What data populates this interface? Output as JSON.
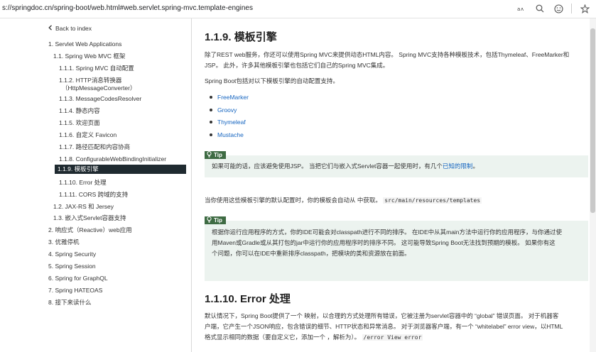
{
  "browser": {
    "url": "s://springdoc.cn/spring-boot/web.html#web.servlet.spring-mvc.template-engines",
    "icons": [
      "reader-mode-icon",
      "zoom-icon",
      "translate-icon",
      "favorite-icon"
    ]
  },
  "sidebar": {
    "back_label": "Back to index",
    "items": [
      "1. Servlet Web Applications",
      "1.1. Spring Web MVC 框架",
      "1.1.1. Spring MVC 自动配置",
      "1.1.2. HTTP消息转换器",
      "（HttpMessageConverter）",
      "1.1.3. MessageCodesResolver",
      "1.1.4. 静态内容",
      "1.1.5. 欢迎页面",
      "1.1.6. 自定义 Favicon",
      "1.1.7. 路径匹配和内容协商",
      "1.1.8. ConfigurableWebBindingInitializer",
      "1.1.9. 模板引擎",
      "1.1.10. Error 处理",
      "1.1.11. CORS 跨域的支持",
      "1.2. JAX-RS 和 Jersey",
      "1.3. 嵌入式Servlet容器支持",
      "2. 响应式（Reactive）web应用",
      "3. 优雅停机",
      "4. Spring Security",
      "5. Spring Session",
      "6. Spring for GraphQL",
      "7. Spring HATEOAS",
      "8. 接下来读什么"
    ]
  },
  "content": {
    "heading1": "1.1.9. 模板引擎",
    "p1_line1": "除了REST web服务，你还可以使用Spring MVC来提供动态HTML内容。 Spring MVC支持各种模板技术，包括Thymeleaf、FreeMarker和",
    "p1_line2": "JSP。 此外，许多其他模板引擎也包括它们自己的Spring MVC集成。",
    "p2": "Spring Boot包括对以下模板引擎的自动配置支持。",
    "engines": [
      "FreeMarker",
      "Groovy",
      "Thymeleaf",
      "Mustache"
    ],
    "tip_label": "Tip",
    "tip1_text": "如果可能的话，应该避免使用JSP。 当把它们与嵌入式Servlet容器一起使用时，有几个",
    "tip1_link": "已知的限制",
    "tip1_end": "。",
    "p3_text": "当你使用这些模板引擎的默认配置时，你的模板会自动从 中获取。",
    "p3_code": "src/main/resources/templates",
    "tip2_line1": "根据你运行应用程序的方式，你的IDE可能会对classpath进行不同的排序。 在IDE中从其main方法中运行你的应用程序，与你通过使",
    "tip2_line2": "用Maven或Gradle或从其打包的jar中运行你的应用程序时的排序不同。 这可能导致Spring Boot无法找到预期的模板。 如果你有这",
    "tip2_line3": "个问题，你可以在IDE中重新排序classpath，把模块的类和资源放在前面。",
    "heading2": "1.1.10. Error 处理",
    "p4_line1": "默认情况下，Spring Boot提供了一个 映射，以合理的方式处理所有错误，它被注册为servlet容器中的 “global” 错误页面。 对于机器客",
    "p4_line2": "户端，它产生一个JSON响应，包含错误的细节、HTTP状态和异常消息。 对于浏览器客户端，有一个 “whitelabel” error view，以HTML",
    "p4_line3": "格式显示相同的数据（要自定义它，添加一个 ，解析为）。",
    "p4_code": "/error View error"
  }
}
